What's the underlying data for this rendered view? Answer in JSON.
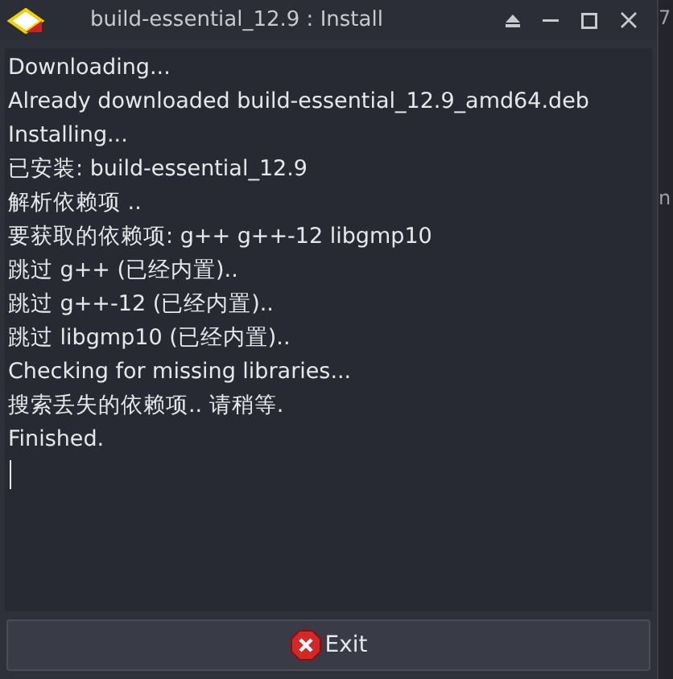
{
  "window": {
    "title": "build-essential_12.9 : Install"
  },
  "log": [
    "Downloading...",
    "Already downloaded build-essential_12.9_amd64.deb",
    "Installing...",
    "已安装: build-essential_12.9",
    "解析依赖项 ..",
    "要获取的依赖项: g++ g++-12 libgmp10",
    "跳过 g++ (已经内置)..",
    "跳过 g++-12 (已经内置)..",
    "跳过 libgmp10 (已经内置)..",
    "Checking for missing libraries...",
    "搜索丢失的依赖项.. 请稍等.",
    "Finished."
  ],
  "buttons": [
    {
      "label": "Exit"
    }
  ],
  "background_window": {
    "texts": [
      "7",
      "n"
    ]
  }
}
